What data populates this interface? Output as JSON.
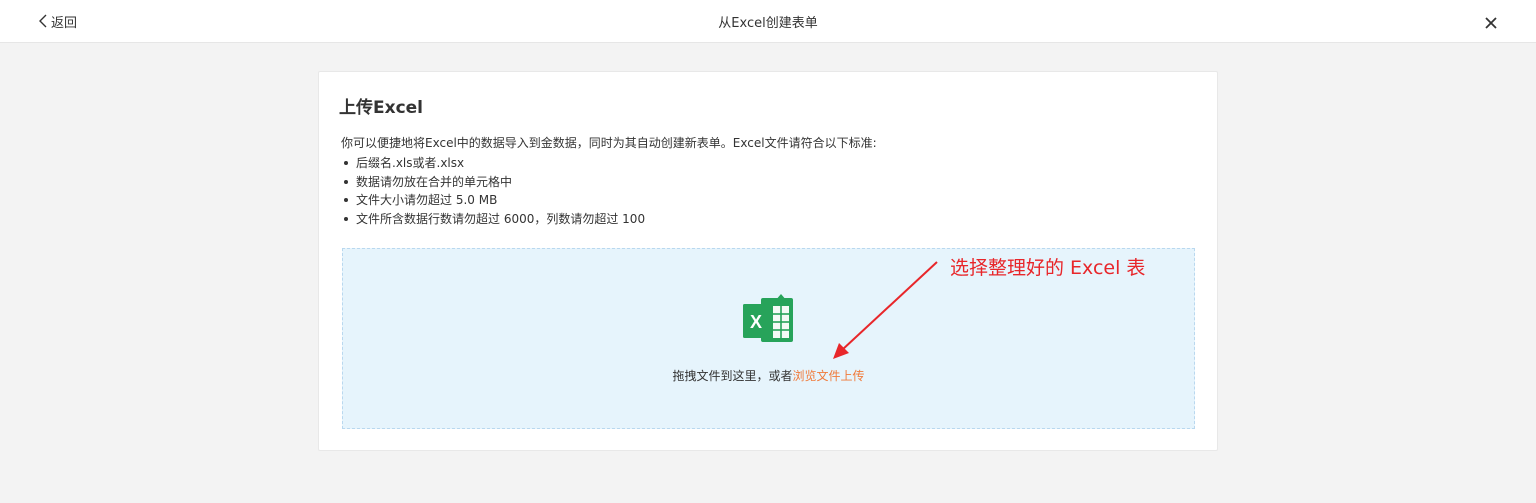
{
  "header": {
    "back_label": "返回",
    "title": "从Excel创建表单"
  },
  "card": {
    "title": "上传Excel",
    "intro": "你可以便捷地将Excel中的数据导入到金数据，同时为其自动创建新表单。Excel文件请符合以下标准:",
    "rules": [
      "后缀名.xls或者.xlsx",
      "数据请勿放在合并的单元格中",
      "文件大小请勿超过 5.0 MB",
      "文件所含数据行数请勿超过 6000，列数请勿超过 100"
    ]
  },
  "dropzone": {
    "drag_text": "拖拽文件到这里，或者",
    "browse_link": "浏览文件上传"
  },
  "annotation": {
    "text": "选择整理好的 Excel 表"
  },
  "colors": {
    "accent": "#f07a3a",
    "excel_green": "#27a35a",
    "annotation_red": "#e8262a",
    "dropzone_bg": "#e6f4fc"
  }
}
